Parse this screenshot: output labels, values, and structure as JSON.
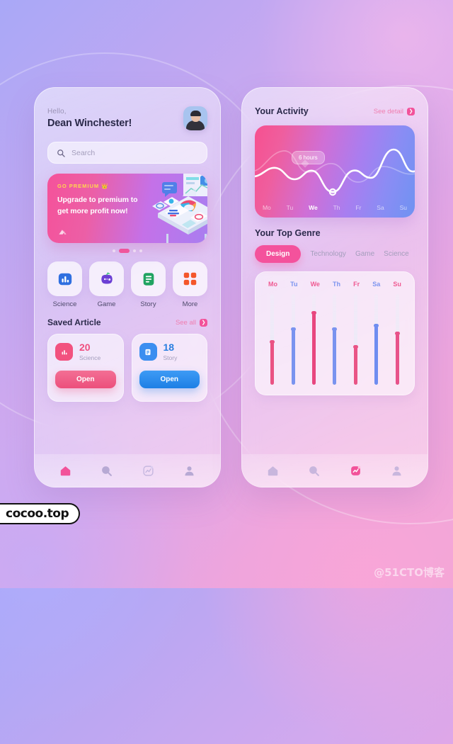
{
  "background": {
    "gradient_from": "#a9a8f7",
    "gradient_to": "#f0a6d6"
  },
  "watermarks": {
    "brand": "cocoo.top",
    "site": "@51CTO博客"
  },
  "left_phone": {
    "header": {
      "greeting": "Hello,",
      "user_name": "Dean Winchester!",
      "avatar_name": "user-avatar"
    },
    "search": {
      "placeholder": "Search",
      "icon": "search-icon"
    },
    "banner": {
      "eyebrow": "GO PREMIUM",
      "eyebrow_emoji": "👑",
      "line1": "Upgrade to premium to",
      "line2": "get more profit now!",
      "eyebrow_color": "#ffd84d",
      "gradient_from": "#f5529a",
      "gradient_to": "#a97ef0"
    },
    "carousel": {
      "total": 4,
      "active_index": 1
    },
    "categories": [
      {
        "label": "Science",
        "icon": "bar-chart-icon",
        "color": "#2f6fe0"
      },
      {
        "label": "Game",
        "icon": "gamepad-icon",
        "color": "#6b3fd4"
      },
      {
        "label": "Story",
        "icon": "document-icon",
        "color": "#21a361"
      },
      {
        "label": "More",
        "icon": "grid-icon",
        "color": "#f4562a"
      }
    ],
    "saved_article": {
      "title": "Saved Article",
      "see_all_label": "See all",
      "see_all_icon": "chevron-right-icon",
      "cards": [
        {
          "count": "20",
          "label": "Science",
          "button": "Open",
          "icon": "bar-chart-icon",
          "color": "#ef4f7f",
          "icon_bg": "#f2527f",
          "btn_from": "#f36f94",
          "btn_to": "#ec4f7c"
        },
        {
          "count": "18",
          "label": "Story",
          "button": "Open",
          "icon": "document-icon",
          "color": "#2a7fe0",
          "icon_bg": "#3b8ef0",
          "btn_from": "#3e9bf5",
          "btn_to": "#1d7fe5"
        }
      ]
    },
    "nav": {
      "active_index": 0,
      "items": [
        {
          "name": "home",
          "icon": "home-icon"
        },
        {
          "name": "search",
          "icon": "search-icon"
        },
        {
          "name": "activity",
          "icon": "activity-icon"
        },
        {
          "name": "profile",
          "icon": "person-icon"
        }
      ],
      "active_color": "#f2529a",
      "inactive_color": "#b7a9d4"
    }
  },
  "right_phone": {
    "activity": {
      "title": "Your Activity",
      "see_detail_label": "See detail",
      "see_detail_icon": "chevron-right-icon",
      "tooltip": "6 hours",
      "active_day": "We",
      "days": [
        "Mo",
        "Tu",
        "We",
        "Th",
        "Fr",
        "Sa",
        "Su"
      ]
    },
    "top_genre": {
      "title": "Your Top Genre",
      "tabs": [
        "Design",
        "Technology",
        "Game",
        "Science"
      ],
      "active_tab": "Design"
    },
    "nav": {
      "active_index": 2,
      "items": [
        {
          "name": "home",
          "icon": "home-icon"
        },
        {
          "name": "search",
          "icon": "search-icon"
        },
        {
          "name": "activity",
          "icon": "activity-icon"
        },
        {
          "name": "profile",
          "icon": "person-icon"
        }
      ],
      "active_color": "#f2529a",
      "inactive_color": "#c8b6dd"
    }
  },
  "chart_data": [
    {
      "type": "line",
      "title": "Your Activity",
      "categories": [
        "Mo",
        "Tu",
        "We",
        "Th",
        "Fr",
        "Sa",
        "Su"
      ],
      "values": [
        5.2,
        4.6,
        6.0,
        5.6,
        5.1,
        8.4,
        6.2
      ],
      "ylabel": "hours",
      "annotation": "6 hours",
      "annotation_point": "We",
      "grid": false,
      "legend": "none",
      "line_color": "#ffffff"
    },
    {
      "type": "bar",
      "title": "Your Top Genre",
      "categories": [
        "Mo",
        "Tu",
        "We",
        "Th",
        "Fr",
        "Sa",
        "Su"
      ],
      "values": [
        48,
        62,
        80,
        62,
        42,
        66,
        57
      ],
      "ylim": [
        0,
        100
      ],
      "series": [
        {
          "name": "Design",
          "values": [
            48,
            62,
            80,
            62,
            42,
            66,
            57
          ],
          "colors": [
            "#ea5283",
            "#7a93ef",
            "#e8467f",
            "#7a93ef",
            "#e95486",
            "#6f8df0",
            "#e8528a"
          ]
        }
      ],
      "label_colors": [
        "#ef5a92",
        "#7c94ef",
        "#ef5a92",
        "#7c94ef",
        "#ef5a92",
        "#7c94ef",
        "#ef5a92"
      ],
      "track_color": "#e7ebf6",
      "grid": false,
      "legend": "none"
    }
  ]
}
